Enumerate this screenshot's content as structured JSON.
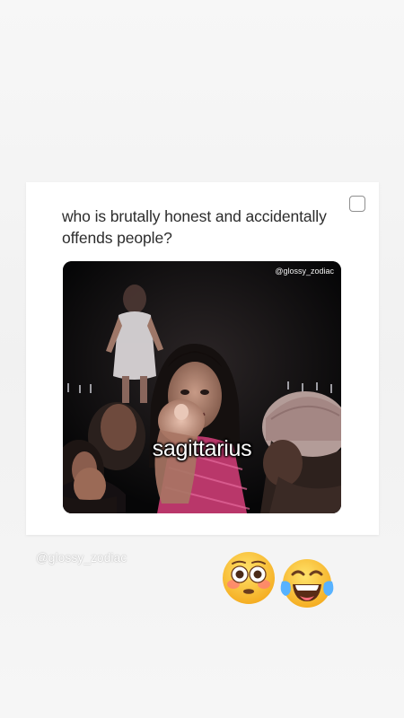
{
  "post": {
    "text": "who is brutally honest and accidentally offends people?",
    "image": {
      "watermark": "@glossy_zodiac",
      "caption": "sagittarius"
    }
  },
  "story": {
    "mention": "@glossy_zodiac",
    "stickers": [
      "flushed-face-emoji",
      "face-with-tears-of-joy-emoji"
    ]
  }
}
